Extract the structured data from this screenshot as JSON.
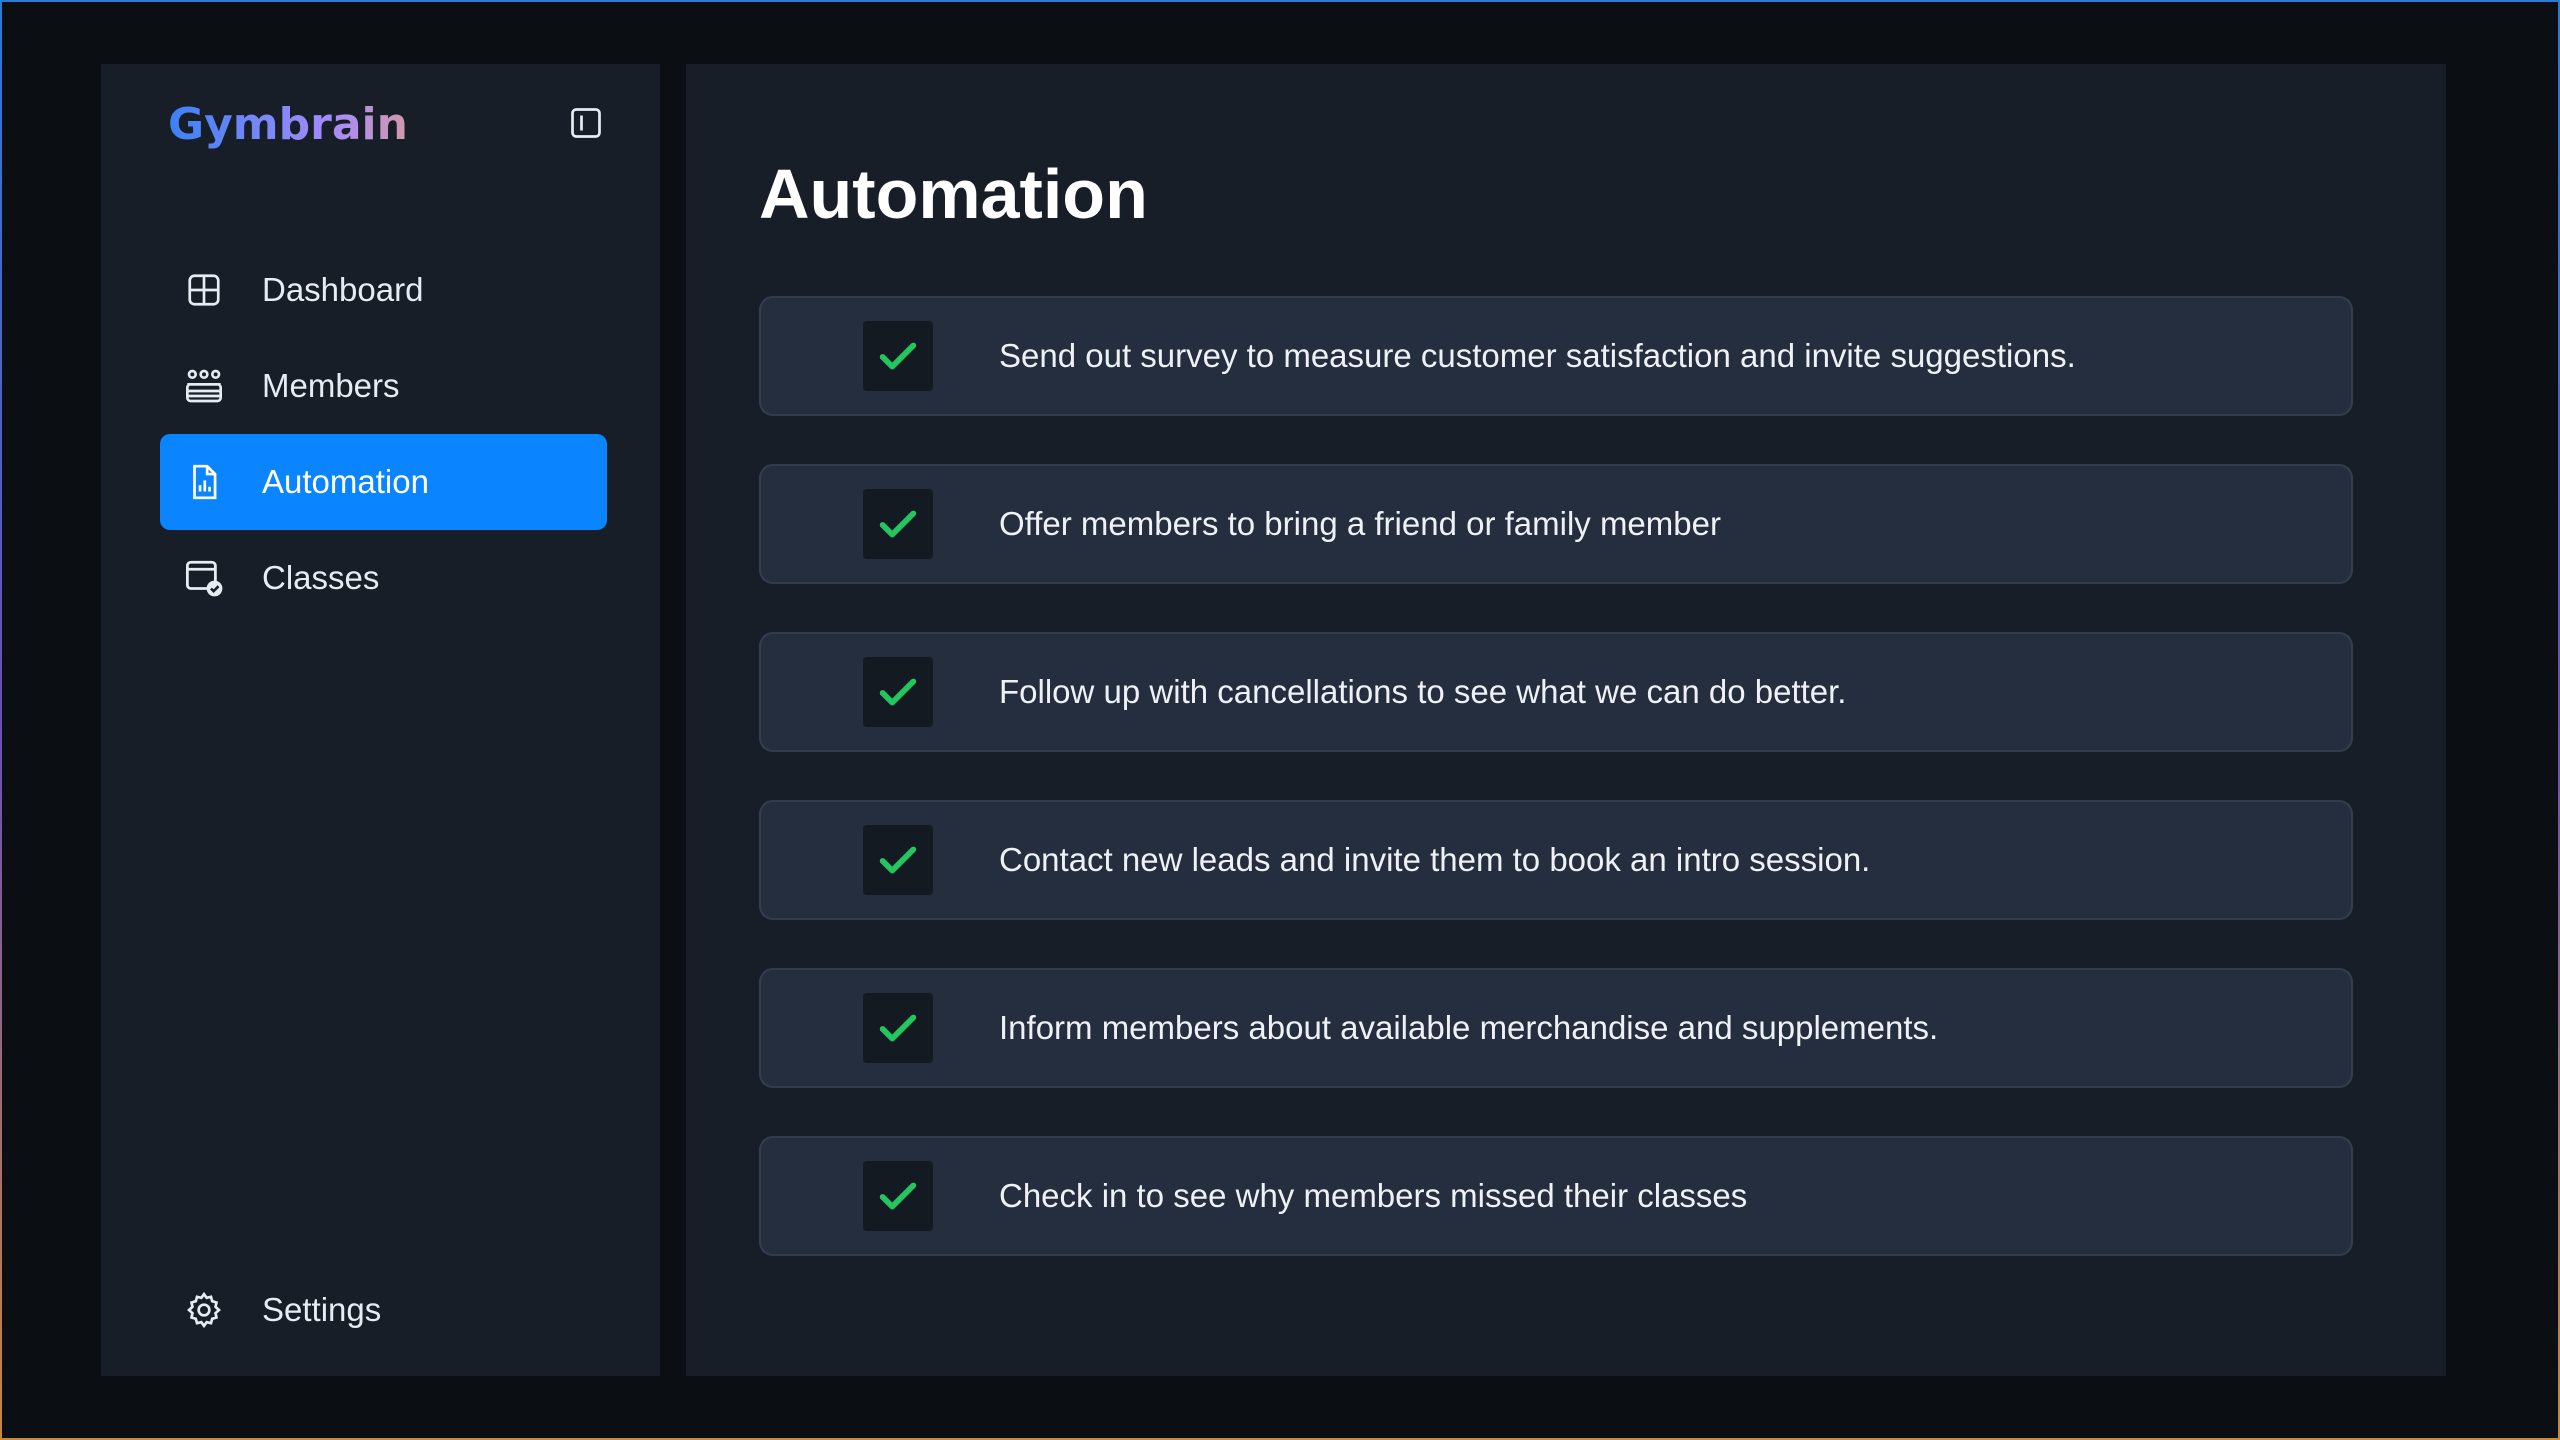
{
  "app": {
    "brand": "Gymbrain"
  },
  "sidebar": {
    "items": [
      {
        "label": "Dashboard",
        "icon": "grid-icon"
      },
      {
        "label": "Members",
        "icon": "users-icon"
      },
      {
        "label": "Automation",
        "icon": "report-icon",
        "active": true
      },
      {
        "label": "Classes",
        "icon": "calendar-check-icon"
      }
    ],
    "settings_label": "Settings"
  },
  "main": {
    "title": "Automation",
    "tasks": [
      {
        "text": "Send out survey to measure customer satisfaction and invite suggestions.",
        "checked": true
      },
      {
        "text": "Offer members to bring a friend or family member",
        "checked": true
      },
      {
        "text": "Follow up with cancellations to see what we can do better.",
        "checked": true
      },
      {
        "text": "Contact new leads and invite them to book an intro session.",
        "checked": true
      },
      {
        "text": "Inform members about available merchandise and supplements.",
        "checked": true
      },
      {
        "text": "Check in to see why members missed their classes",
        "checked": true
      }
    ]
  },
  "colors": {
    "accent": "#0a84ff",
    "check": "#22c55e",
    "panel": "#171e28",
    "row": "#252e3e"
  }
}
